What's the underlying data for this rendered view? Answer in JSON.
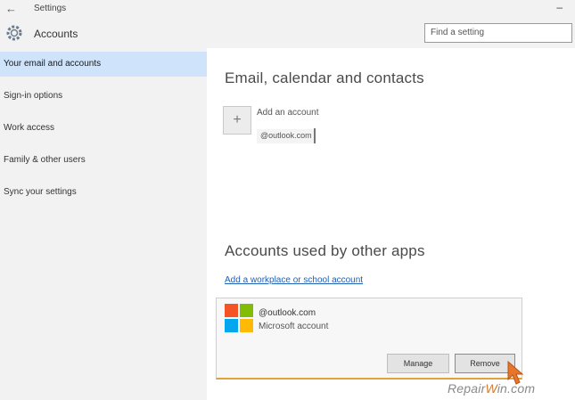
{
  "window": {
    "title": "Settings",
    "back_glyph": "←",
    "minimize_glyph": "–"
  },
  "header": {
    "title": "Accounts",
    "search_placeholder": "Find a setting"
  },
  "sidebar": {
    "items": [
      {
        "label": "Your email and accounts",
        "active": true
      },
      {
        "label": "Sign-in options",
        "active": false
      },
      {
        "label": "Work access",
        "active": false
      },
      {
        "label": "Family & other users",
        "active": false
      },
      {
        "label": "Sync your settings",
        "active": false
      }
    ]
  },
  "email_section": {
    "heading": "Email, calendar and contacts",
    "add_account_label": "Add an account",
    "existing_account": "@outlook.com"
  },
  "apps_section": {
    "heading": "Accounts used by other apps",
    "add_link": "Add a workplace or school account",
    "account": {
      "email": "@outlook.com",
      "type": "Microsoft account",
      "manage_label": "Manage",
      "remove_label": "Remove"
    }
  },
  "watermark": {
    "prefix": "Repair",
    "accent": "W",
    "suffix": "in.com"
  },
  "colors": {
    "accent": "#cfe3fa",
    "link": "#1f5fb5",
    "highlight_border": "#e0a33a"
  },
  "icons": [
    "back-arrow-icon",
    "gear-icon",
    "plus-icon",
    "microsoft-logo-icon",
    "cursor-icon"
  ]
}
